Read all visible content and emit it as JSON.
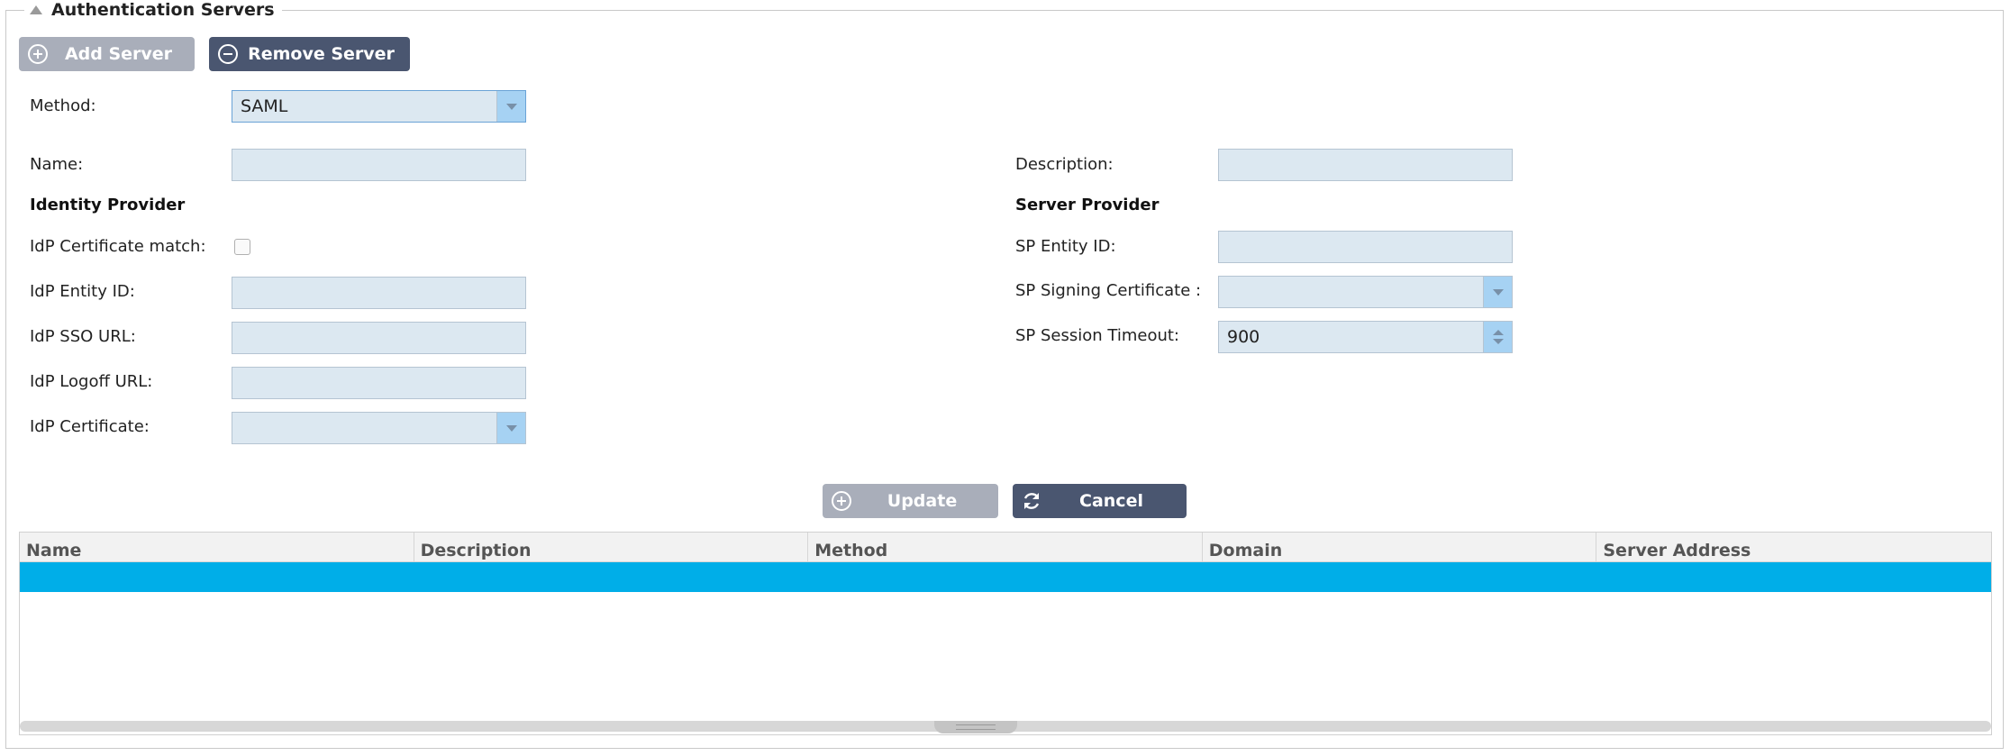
{
  "panel": {
    "title": "Authentication Servers"
  },
  "toolbar": {
    "add_label": "Add Server",
    "remove_label": "Remove Server"
  },
  "form": {
    "method_label": "Method:",
    "method_value": "SAML",
    "name_label": "Name:",
    "name_value": "",
    "description_label": "Description:",
    "description_value": "",
    "identity_provider_heading": "Identity Provider",
    "server_provider_heading": "Server Provider",
    "idp_cert_match_label": "IdP Certificate match:",
    "idp_cert_match_checked": false,
    "idp_entity_id_label": "IdP Entity ID:",
    "idp_entity_id_value": "",
    "idp_sso_url_label": "IdP SSO URL:",
    "idp_sso_url_value": "",
    "idp_logoff_url_label": "IdP Logoff URL:",
    "idp_logoff_url_value": "",
    "idp_certificate_label": "IdP Certificate:",
    "idp_certificate_value": "",
    "sp_entity_id_label": "SP Entity ID:",
    "sp_entity_id_value": "",
    "sp_signing_cert_label": "SP Signing Certificate :",
    "sp_signing_cert_value": "",
    "sp_session_timeout_label": "SP Session Timeout:",
    "sp_session_timeout_value": "900"
  },
  "actions": {
    "update_label": "Update",
    "cancel_label": "Cancel"
  },
  "table": {
    "columns": [
      "Name",
      "Description",
      "Method",
      "Domain",
      "Server Address"
    ]
  },
  "colors": {
    "accent": "#00aee8",
    "button_dark": "#4a5670",
    "button_light": "#a9aeba",
    "input_bg": "#dce8f1"
  }
}
